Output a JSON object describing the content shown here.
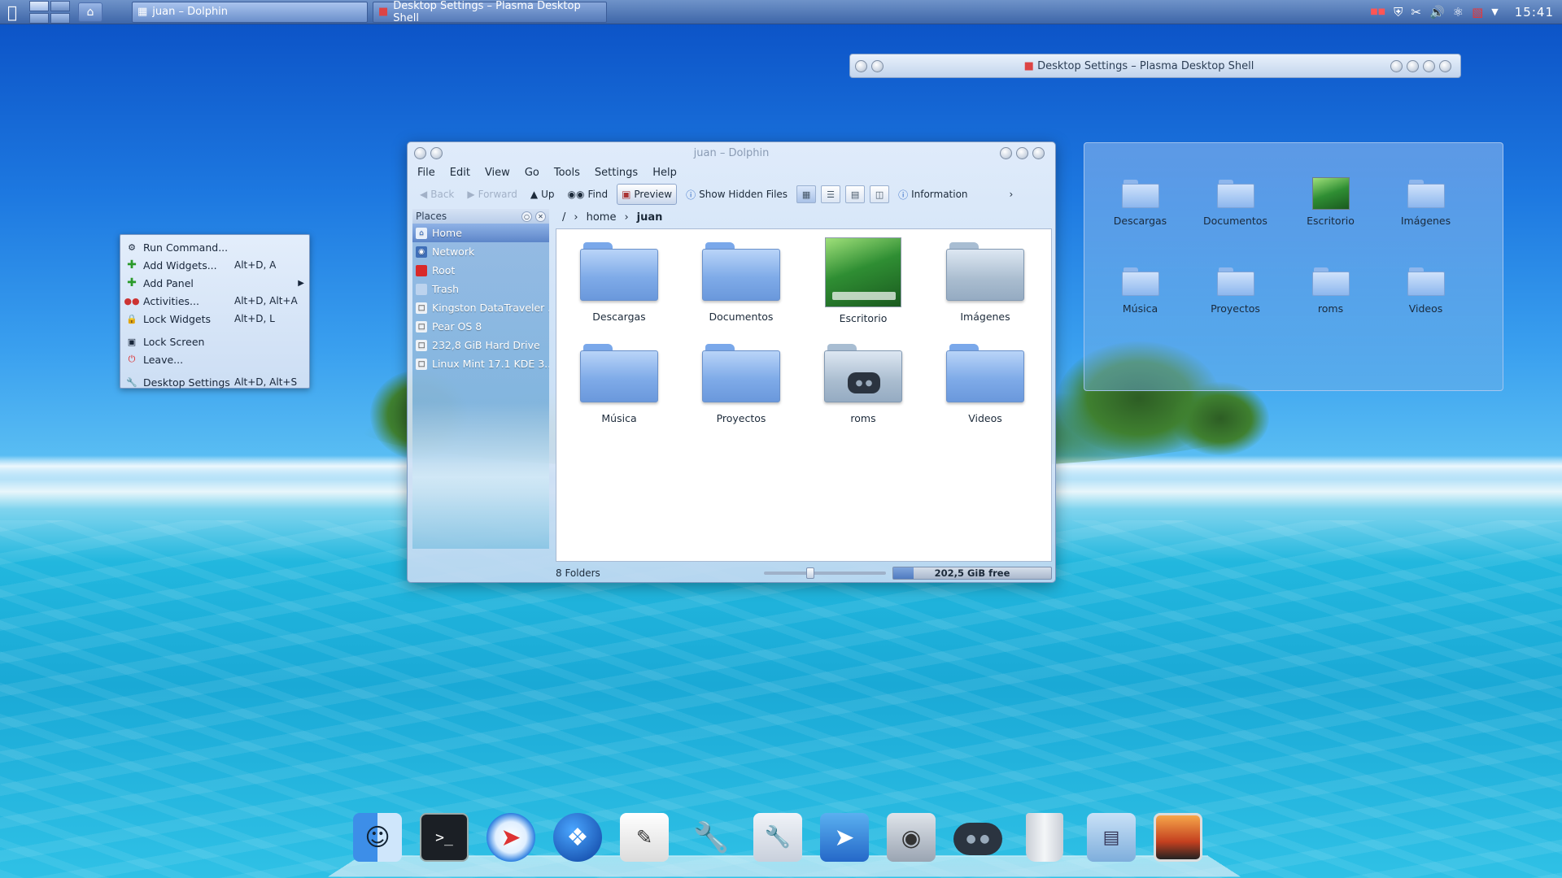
{
  "taskbar": {
    "tasks": [
      "juan – Dolphin",
      "Desktop Settings – Plasma Desktop Shell"
    ],
    "clock": "15:41"
  },
  "desktop_settings_window": {
    "title": "Desktop Settings – Plasma Desktop Shell"
  },
  "context_menu": {
    "items": [
      {
        "label": "Run Command...",
        "shortcut": ""
      },
      {
        "label": "Add Widgets...",
        "shortcut": "Alt+D, A"
      },
      {
        "label": "Add Panel",
        "shortcut": ""
      },
      {
        "label": "Activities...",
        "shortcut": "Alt+D, Alt+A"
      },
      {
        "label": "Lock Widgets",
        "shortcut": "Alt+D, L"
      },
      {
        "label": "Lock Screen",
        "shortcut": ""
      },
      {
        "label": "Leave...",
        "shortcut": ""
      },
      {
        "label": "Desktop Settings",
        "shortcut": "Alt+D, Alt+S"
      }
    ]
  },
  "dolphin": {
    "title": "juan – Dolphin",
    "menus": [
      "File",
      "Edit",
      "View",
      "Go",
      "Tools",
      "Settings",
      "Help"
    ],
    "toolbar": {
      "back": "Back",
      "forward": "Forward",
      "up": "Up",
      "find": "Find",
      "preview": "Preview",
      "show_hidden": "Show Hidden Files",
      "information": "Information"
    },
    "places": {
      "header": "Places",
      "items": [
        "Home",
        "Network",
        "Root",
        "Trash",
        "Kingston DataTraveler ...",
        "Pear OS 8",
        "232,8 GiB Hard Drive",
        "Linux Mint 17.1 KDE 3..."
      ]
    },
    "breadcrumb": {
      "root": "/",
      "parent": "home",
      "current": "juan"
    },
    "files": [
      "Descargas",
      "Documentos",
      "Escritorio",
      "Imágenes",
      "Música",
      "Proyectos",
      "roms",
      "Videos"
    ],
    "status": {
      "folders": "8 Folders",
      "free": "202,5 GiB free",
      "used_fraction": 0.13
    }
  },
  "folder_view": {
    "items": [
      "Descargas",
      "Documentos",
      "Escritorio",
      "Imágenes",
      "Música",
      "Proyectos",
      "roms",
      "Videos"
    ]
  },
  "dock": {
    "icons": [
      "finder-icon",
      "terminal-icon",
      "safari-icon",
      "dolphin-icon",
      "text-editor-icon",
      "system-tools-icon",
      "preferences-icon",
      "pointer-app-icon",
      "camera-icon",
      "gamepad-icon",
      "trash-icon",
      "file-cabinet-icon",
      "display-icon"
    ]
  },
  "colors": {
    "accent": "#5d86c9",
    "panel": "#3e66a8"
  }
}
